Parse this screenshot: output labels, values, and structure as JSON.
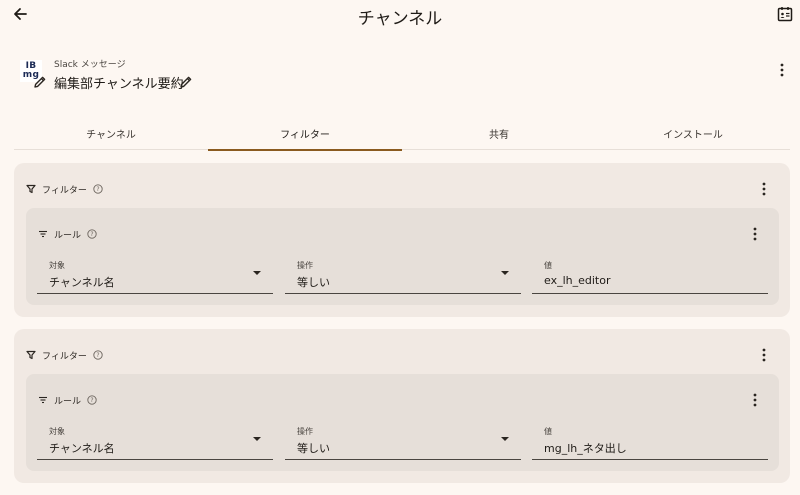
{
  "topbar": {
    "title": "チャンネル",
    "back_icon": "arrow-left-icon",
    "action_icon": "contact-card-icon"
  },
  "header": {
    "subtitle": "Slack メッセージ",
    "title": "編集部チャンネル要約",
    "logo_text": "IB mg",
    "logo_color": "#1a2a55"
  },
  "tabs": [
    {
      "label": "チャンネル",
      "active": false
    },
    {
      "label": "フィルター",
      "active": true
    },
    {
      "label": "共有",
      "active": false
    },
    {
      "label": "インストール",
      "active": false
    }
  ],
  "filters": [
    {
      "label": "フィルター",
      "rule": {
        "label": "ルール",
        "target": {
          "label": "対象",
          "value": "チャンネル名"
        },
        "operator": {
          "label": "操作",
          "value": "等しい"
        },
        "value": {
          "label": "値",
          "value": "ex_lh_editor"
        }
      }
    },
    {
      "label": "フィルター",
      "rule": {
        "label": "ルール",
        "target": {
          "label": "対象",
          "value": "チャンネル名"
        },
        "operator": {
          "label": "操作",
          "value": "等しい"
        },
        "value": {
          "label": "値",
          "value": "mg_lh_ネタ出し"
        }
      }
    }
  ],
  "colors": {
    "background": "#fdf7f2",
    "accent": "#8a5a1f",
    "card": "#f1e9e3",
    "rule": "#e6dfd9"
  }
}
